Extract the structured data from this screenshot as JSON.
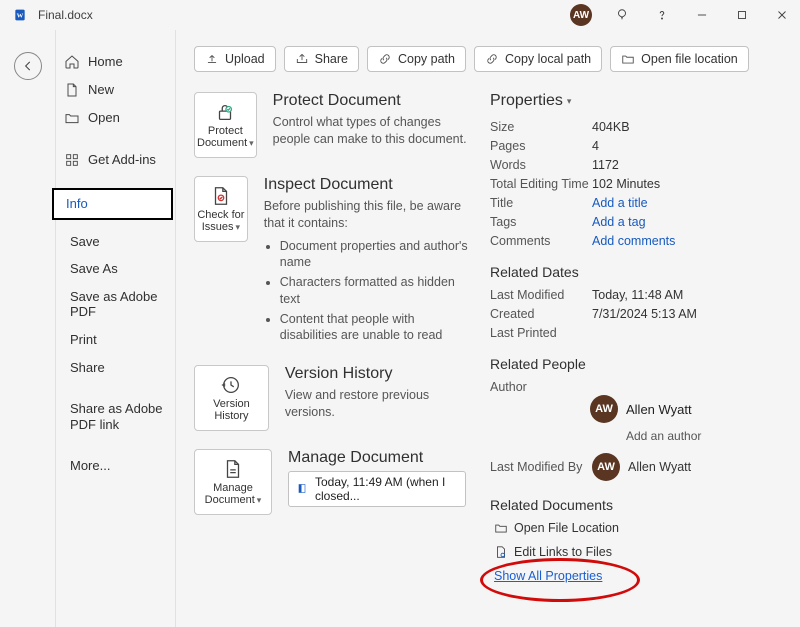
{
  "title_file": "Final.docx",
  "avatar_initials": "AW",
  "toolbar": {
    "upload": "Upload",
    "share": "Share",
    "copy_path": "Copy path",
    "copy_local_path": "Copy local path",
    "open_loc": "Open file location"
  },
  "nav": {
    "home": "Home",
    "new": "New",
    "open": "Open",
    "addins": "Get Add-ins",
    "info": "Info",
    "save": "Save",
    "save_as": "Save As",
    "save_as_adobe": "Save as Adobe PDF",
    "print": "Print",
    "share": "Share",
    "share_as_adobe": "Share as Adobe PDF link",
    "more": "More..."
  },
  "tiles": {
    "protect": "Protect Document",
    "check": "Check for Issues",
    "version": "Version History",
    "manage": "Manage Document"
  },
  "sections": {
    "protect_title": "Protect Document",
    "protect_desc": "Control what types of changes people can make to this document.",
    "inspect_title": "Inspect Document",
    "inspect_desc": "Before publishing this file, be aware that it contains:",
    "inspect_items": [
      "Document properties and author's name",
      "Characters formatted as hidden text",
      "Content that people with disabilities are unable to read"
    ],
    "vh_title": "Version History",
    "vh_desc": "View and restore previous versions.",
    "mgd_title": "Manage Document",
    "mgd_autosave": "Today, 11:49 AM (when I closed..."
  },
  "props": {
    "heading": "Properties",
    "kv": [
      {
        "k": "Size",
        "v": "404KB"
      },
      {
        "k": "Pages",
        "v": "4"
      },
      {
        "k": "Words",
        "v": "1172"
      },
      {
        "k": "Total Editing Time",
        "v": "102 Minutes"
      },
      {
        "k": "Title",
        "v": "Add a title",
        "link": true
      },
      {
        "k": "Tags",
        "v": "Add a tag",
        "link": true
      },
      {
        "k": "Comments",
        "v": "Add comments",
        "link": true
      }
    ],
    "related_dates": "Related Dates",
    "dates": [
      {
        "k": "Last Modified",
        "v": "Today, 11:48 AM"
      },
      {
        "k": "Created",
        "v": "7/31/2024 5:13 AM"
      },
      {
        "k": "Last Printed",
        "v": ""
      }
    ],
    "related_people": "Related People",
    "author_label": "Author",
    "author_name": "Allen Wyatt",
    "add_author": "Add an author",
    "lastmodby_label": "Last Modified By",
    "lastmodby_name": "Allen Wyatt",
    "related_docs": "Related Documents",
    "open_file_loc": "Open File Location",
    "edit_links": "Edit Links to Files",
    "show_all": "Show All Properties"
  }
}
